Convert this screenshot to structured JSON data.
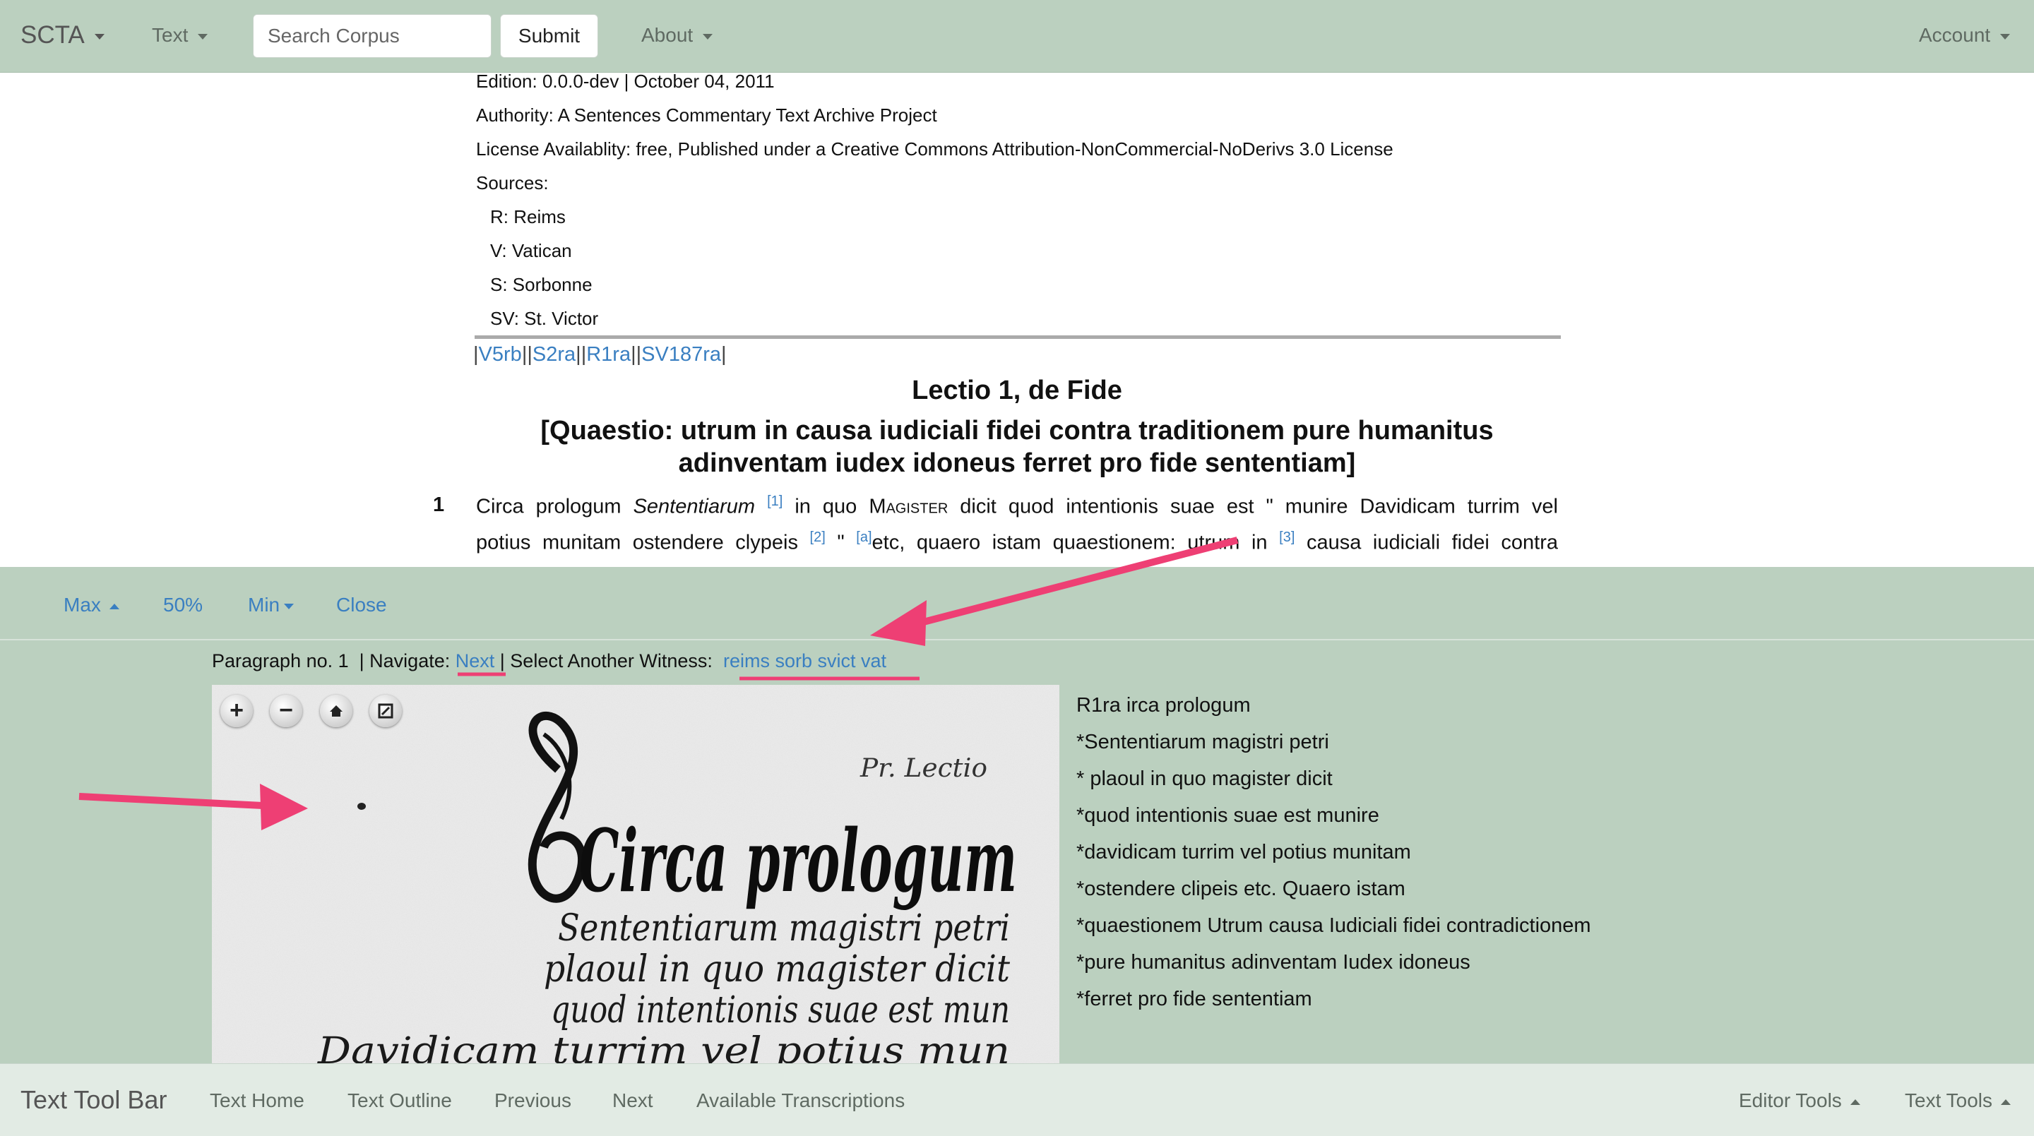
{
  "navbar": {
    "brand": "SCTA",
    "text_menu": "Text",
    "search_placeholder": "Search Corpus",
    "submit_label": "Submit",
    "about_menu": "About",
    "account_menu": "Account"
  },
  "document": {
    "meta": [
      "Edition: 0.0.0-dev | October 04, 2011",
      "Authority: A Sentences Commentary Text Archive Project",
      "License Availablity: free, Published under a Creative Commons Attribution-NonCommercial-NoDerivs 3.0 License",
      "Sources:"
    ],
    "sources": [
      "R: Reims",
      "V: Vatican",
      "S: Sorbonne",
      "SV: St. Victor"
    ],
    "folios": [
      "V5rb",
      "S2ra",
      "R1ra",
      "SV187ra"
    ],
    "title": "Lectio 1, de Fide",
    "question_line1": "[Quaestio: utrum in causa iudiciali fidei contra traditionem pure humanitus",
    "question_line2": "adinventam iudex idoneus ferret pro fide sententiam]",
    "paragraph_number": "1",
    "line1": {
      "a": "Circa prologum ",
      "b": "Sententiarum",
      "fn1": "[1]",
      "c": " in quo ",
      "d": "Magister",
      "e": " dicit quod intentionis suae est \" munire Davidicam turrim vel"
    },
    "line2": {
      "a": "potius munitam ostendere clypeis ",
      "fn2": "[2]",
      "b": " \" ",
      "fna": "[a]",
      "c": "etc, quaero istam quaestionem: utrum in ",
      "fn3": "[3]",
      "d": " causa iudiciali fidei contra"
    }
  },
  "viewer": {
    "toolbar": {
      "max": "Max",
      "half": "50%",
      "min": "Min",
      "close": "Close"
    },
    "nav": {
      "paragraph": "Paragraph no. 1",
      "navigate_label": "| Navigate: ",
      "next": "Next",
      "witness_label": " | Select Another Witness: ",
      "witnesses": [
        "reims",
        "sorb",
        "svict",
        "vat"
      ]
    },
    "zoom_controls": [
      "zoom-in-icon",
      "zoom-out-icon",
      "home-icon",
      "fullscreen-icon"
    ],
    "manuscript_text": {
      "main": "Circa prologum",
      "line2": "Sententiarum magistri petri",
      "line3": "plaoul in quo magister dicit",
      "line4": "quod intentionis suae est mun",
      "line5": "Davidicam turrim vel potius mun",
      "margin": "Pr. Lectio"
    },
    "transcription": [
      "R1ra irca prologum",
      "*Sententiarum magistri petri",
      "* plaoul in quo magister dicit",
      "*quod intentionis suae est munire",
      "*davidicam turrim vel potius munitam",
      "*ostendere clipeis etc. Quaero istam",
      "*quaestionem Utrum causa Iudiciali fidei contradictionem",
      "*pure humanitus adinventam Iudex idoneus",
      "*ferret pro fide sententiam"
    ]
  },
  "bottombar": {
    "brand": "Text Tool Bar",
    "links": [
      "Text Home",
      "Text Outline",
      "Previous",
      "Next",
      "Available Transcriptions"
    ],
    "editor_tools": "Editor Tools",
    "text_tools": "Text Tools"
  },
  "colors": {
    "navbar_bg": "#bbd0bf",
    "link": "#3a7fc1",
    "annotation": "#ee3f74"
  }
}
